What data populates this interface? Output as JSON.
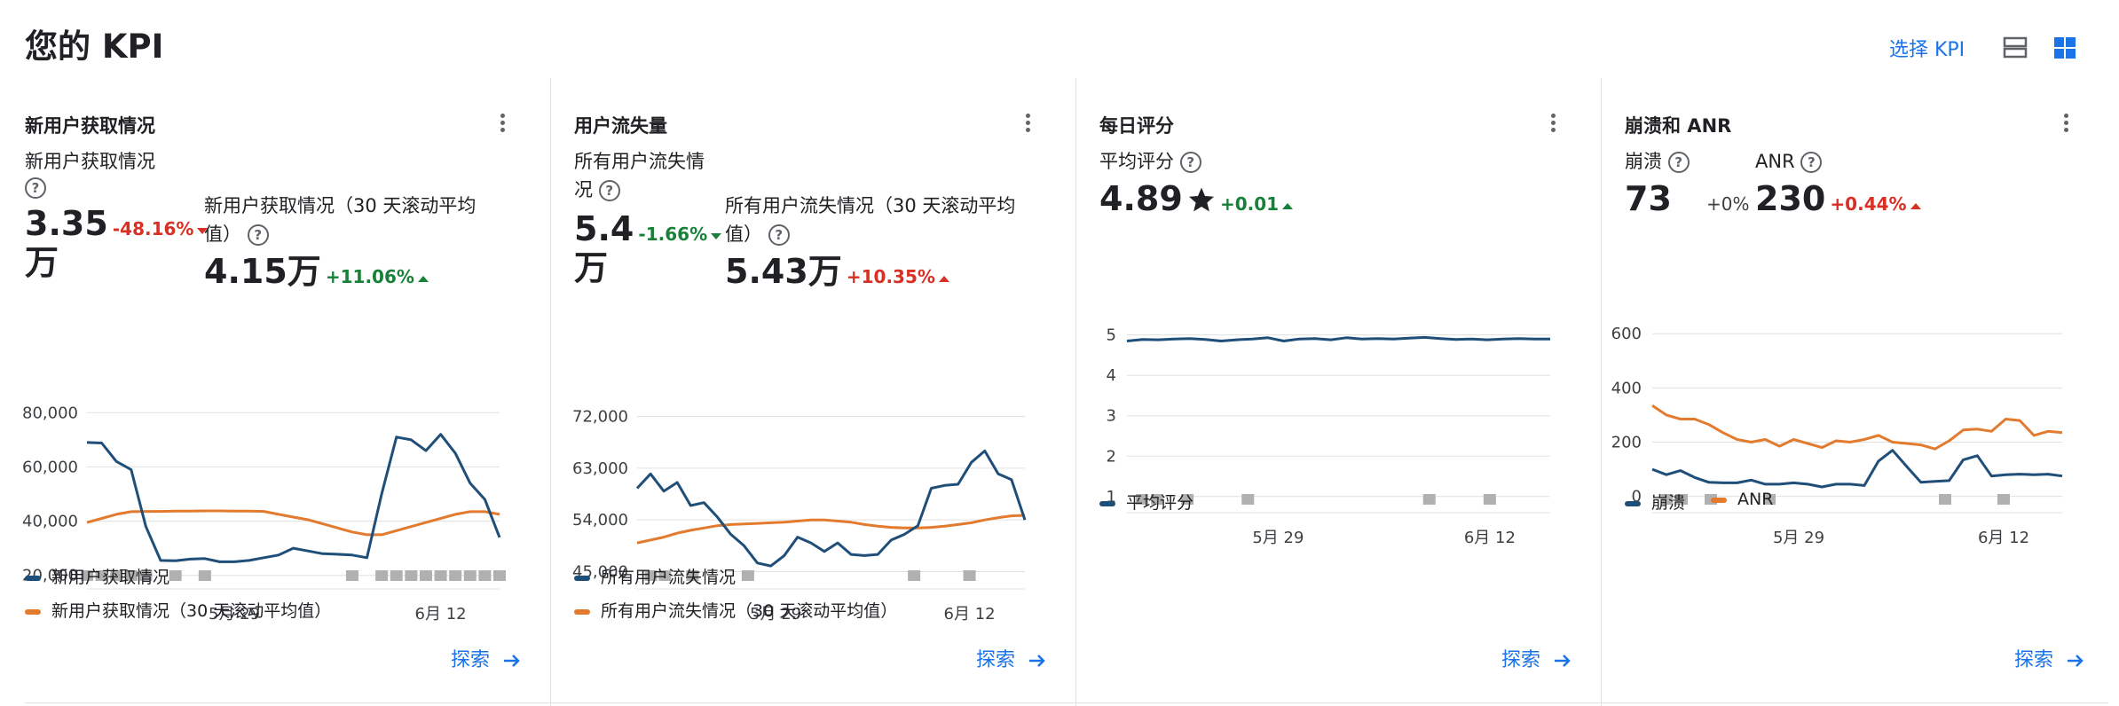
{
  "header": {
    "title": "您的 KPI",
    "select_kpi": "选择 KPI",
    "view_list_icon": "view-list-icon",
    "view_grid_icon": "view-grid-icon"
  },
  "colors": {
    "series_blue": "#1f4e79",
    "series_orange": "#e37b2f",
    "accent": "#1a73e8",
    "negative": "#d93025",
    "positive": "#188038",
    "annotation": "#b0b0b0"
  },
  "explore_label": "探索",
  "cards": [
    {
      "title": "新用户获取情况",
      "metrics": [
        {
          "label": "新用户获取情况",
          "value": "3.35",
          "value_unit": "万",
          "change": "-48.16%",
          "direction": "down",
          "tone": "neg"
        },
        {
          "label": "新用户获取情况（30 天滚动平均值）",
          "value": "4.15万",
          "change": "+11.06%",
          "direction": "up",
          "tone": "pos"
        }
      ],
      "legend": [
        "新用户获取情况",
        "新用户获取情况（30 天滚动平均值）"
      ]
    },
    {
      "title": "用户流失量",
      "metrics": [
        {
          "label": "所有用户流失情况",
          "value": "5.4",
          "value_unit": "万",
          "change": "-1.66%",
          "direction": "down",
          "tone": "pos"
        },
        {
          "label": "所有用户流失情况（30 天滚动平均值）",
          "value": "5.43万",
          "change": "+10.35%",
          "direction": "up",
          "tone": "neg"
        }
      ],
      "legend": [
        "所有用户流失情况",
        "所有用户流失情况（30 天滚动平均值）"
      ]
    },
    {
      "title": "每日评分",
      "metrics": [
        {
          "label": "平均评分",
          "value": "4.89",
          "change": "+0.01",
          "direction": "up",
          "tone": "pos"
        }
      ],
      "legend": [
        "平均评分"
      ]
    },
    {
      "title": "崩溃和 ANR",
      "metrics": [
        {
          "label": "崩溃",
          "value": "73",
          "change": "+0%",
          "direction": "none",
          "tone": "neu"
        },
        {
          "label": "ANR",
          "value": "230",
          "change": "+0.44%",
          "direction": "up",
          "tone": "neg"
        }
      ],
      "legend": [
        "崩溃",
        "ANR"
      ]
    }
  ],
  "chart_data": [
    {
      "type": "line",
      "x_range": [
        "5月 19",
        "6月 16"
      ],
      "x_ticks": [
        "5月 29",
        "6月 12"
      ],
      "y_ticks": [
        "20,000",
        "40,000",
        "60,000",
        "80,000"
      ],
      "ylim": [
        15000,
        85000
      ],
      "series": [
        {
          "name": "新用户获取情况",
          "color": "#1f4e79",
          "values": [
            69000,
            68800,
            62000,
            59000,
            38000,
            25500,
            25400,
            26000,
            26200,
            25000,
            25000,
            25500,
            26500,
            27500,
            30000,
            29000,
            28000,
            27800,
            27500,
            26500,
            50000,
            71000,
            70000,
            66000,
            72000,
            65000,
            54000,
            48000,
            34000
          ]
        },
        {
          "name": "新用户获取情况（30 天滚动平均值）",
          "color": "#e37b2f",
          "values": [
            39500,
            41000,
            42500,
            43500,
            43600,
            43600,
            43700,
            43700,
            43800,
            43800,
            43700,
            43700,
            43600,
            42500,
            41500,
            40500,
            39000,
            37500,
            36000,
            35000,
            35000,
            36500,
            38000,
            39500,
            41000,
            42500,
            43500,
            43500,
            42500
          ]
        }
      ],
      "annotations": [
        "5月 19",
        "5月 20",
        "5月 21",
        "5月 22",
        "5月 23",
        "5月 25",
        "5月 27",
        "6月 6",
        "6月 8",
        "6月 9",
        "6月 10",
        "6月 11",
        "6月 12",
        "6月 13",
        "6月 14",
        "6月 15",
        "6月 16"
      ]
    },
    {
      "type": "line",
      "x_range": [
        "5月 19",
        "6月 16"
      ],
      "x_ticks": [
        "5月 29",
        "6月 12"
      ],
      "y_ticks": [
        "45,000",
        "54,000",
        "63,000",
        "72,000"
      ],
      "ylim": [
        42000,
        75000
      ],
      "series": [
        {
          "name": "所有用户流失情况",
          "color": "#1f4e79",
          "values": [
            59500,
            62000,
            59000,
            60500,
            56500,
            57000,
            54500,
            51500,
            49500,
            46500,
            46000,
            47800,
            51000,
            50000,
            48500,
            50000,
            48000,
            47800,
            48000,
            50500,
            51500,
            53000,
            59500,
            60000,
            60200,
            64000,
            66000,
            62000,
            61000,
            54000
          ]
        },
        {
          "name": "所有用户流失情况（30 天滚动平均值）",
          "color": "#e37b2f",
          "values": [
            50000,
            50500,
            51000,
            51700,
            52200,
            52600,
            53000,
            53200,
            53300,
            53400,
            53500,
            53600,
            53800,
            54000,
            54000,
            53800,
            53600,
            53200,
            52900,
            52700,
            52600,
            52600,
            52700,
            52900,
            53200,
            53500,
            54000,
            54400,
            54700,
            54800
          ]
        }
      ],
      "annotations": [
        "5月 20",
        "5月 21",
        "5月 23",
        "5月 27",
        "6月 8",
        "6月 12"
      ]
    },
    {
      "type": "line",
      "x_range": [
        "5月 19",
        "6月 16"
      ],
      "x_ticks": [
        "5月 29",
        "6月 12"
      ],
      "y_ticks": [
        "1",
        "2",
        "3",
        "4",
        "5"
      ],
      "ylim": [
        0.6,
        5.3
      ],
      "series": [
        {
          "name": "平均评分",
          "color": "#1f4e79",
          "values": [
            4.85,
            4.89,
            4.88,
            4.9,
            4.91,
            4.89,
            4.85,
            4.88,
            4.9,
            4.93,
            4.85,
            4.9,
            4.91,
            4.88,
            4.93,
            4.9,
            4.91,
            4.9,
            4.92,
            4.94,
            4.91,
            4.89,
            4.9,
            4.88,
            4.9,
            4.91,
            4.9,
            4.9
          ]
        }
      ],
      "annotations": [
        "5月 20",
        "5月 21",
        "5月 23",
        "5月 27",
        "6月 8",
        "6月 12"
      ]
    },
    {
      "type": "line",
      "x_range": [
        "5月 19",
        "6月 16"
      ],
      "x_ticks": [
        "5月 29",
        "6月 12"
      ],
      "y_ticks": [
        "0",
        "200",
        "400",
        "600"
      ],
      "ylim": [
        -60,
        640
      ],
      "series": [
        {
          "name": "崩溃",
          "color": "#1f4e79",
          "values": [
            100,
            80,
            95,
            70,
            52,
            50,
            50,
            60,
            45,
            45,
            50,
            45,
            35,
            45,
            45,
            40,
            130,
            170,
            110,
            52,
            55,
            58,
            135,
            150,
            75,
            80,
            82,
            80,
            82,
            75
          ]
        },
        {
          "name": "ANR",
          "color": "#e37b2f",
          "values": [
            335,
            300,
            285,
            285,
            265,
            235,
            210,
            200,
            210,
            185,
            210,
            195,
            180,
            205,
            200,
            210,
            225,
            200,
            195,
            190,
            175,
            205,
            245,
            248,
            240,
            285,
            280,
            225,
            240,
            235
          ]
        }
      ],
      "annotations": [
        "5月 20",
        "5月 21",
        "5月 23",
        "5月 27",
        "6月 8",
        "6月 12"
      ]
    }
  ]
}
